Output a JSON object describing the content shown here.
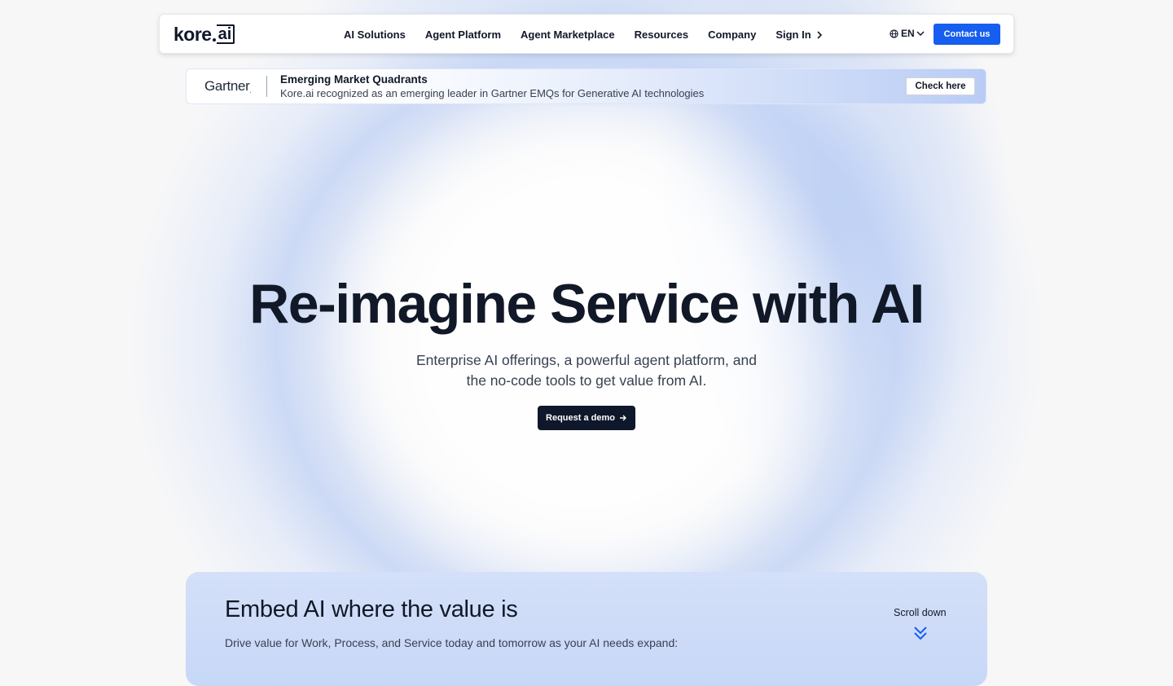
{
  "brand": {
    "logo_main": "kore",
    "logo_suffix": "ai"
  },
  "nav": {
    "links": [
      "AI Solutions",
      "Agent Platform",
      "Agent Marketplace",
      "Resources",
      "Company"
    ],
    "sign_in": "Sign In",
    "language": "EN",
    "contact": "Contact us"
  },
  "banner": {
    "brand": "Gartner",
    "title": "Emerging Market Quadrants",
    "subtitle": "Kore.ai recognized as an emerging leader in Gartner EMQs for Generative AI technologies",
    "button": "Check here"
  },
  "hero": {
    "title": "Re-imagine Service with AI",
    "subtitle_line1": "Enterprise AI offerings, a powerful agent platform, and",
    "subtitle_line2": "the no-code tools to get value from AI.",
    "cta": "Request a demo"
  },
  "embed": {
    "title": "Embed AI where the value is",
    "subtitle": "Drive value for Work, Process, and Service today and tomorrow as your AI needs expand:",
    "scroll_label": "Scroll down"
  },
  "colors": {
    "accent": "#155eef",
    "dark": "#0f172a",
    "text": "#111827"
  }
}
